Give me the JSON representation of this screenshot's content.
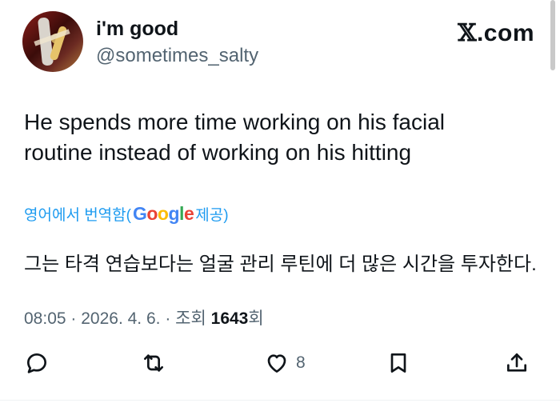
{
  "author": {
    "display_name": "i'm good",
    "handle": "@sometimes_salty"
  },
  "brand": {
    "logo": "𝕏",
    "suffix": ".com"
  },
  "tweet": {
    "line1": "He spends more time working on his facial",
    "line2": "routine instead of working on his hitting"
  },
  "translation": {
    "label": "영어에서 번역함(",
    "google": [
      "G",
      "o",
      "o",
      "g",
      "l",
      "e"
    ],
    "provided": " 제공)",
    "text": "그는 타격 연습보다는 얼굴 관리 루틴에 더 많은 시간을 투자한다."
  },
  "meta": {
    "time": "08:05",
    "sep1": " · ",
    "date": "2026. 4. 6.",
    "sep2": " · ",
    "views_label": "조회 ",
    "views": "1643",
    "views_suffix": "회"
  },
  "actions": {
    "reply_icon": "reply-icon",
    "repost_icon": "repost-icon",
    "like_icon": "heart-icon",
    "like_count": "8",
    "bookmark_icon": "bookmark-icon",
    "share_icon": "share-icon"
  },
  "colors": {
    "text": "#0f1419",
    "secondary": "#536471",
    "link": "#1d9bf0"
  }
}
